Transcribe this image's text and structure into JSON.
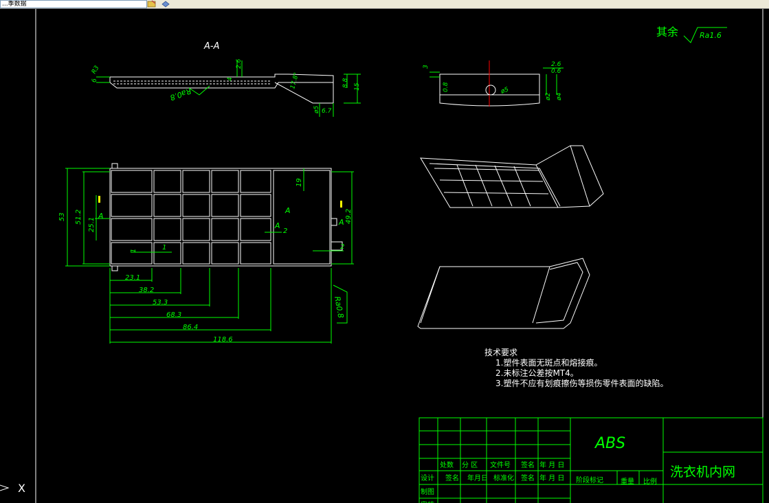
{
  "window": {
    "address_value": "...季数据",
    "colors": {
      "background": "#000000",
      "border": "#ffffff",
      "dim": "#00ff00",
      "frame": "#ffffff"
    }
  },
  "drawing": {
    "section_label": "A-A",
    "surface_finish_note": "其余",
    "surface_finish_value": "Ra1.6",
    "roughness_section": "Ra0.8",
    "roughness_plan": "Ra0.8",
    "material": "ABS",
    "company": "洗衣机内网",
    "section_dims": [
      "R3",
      "6",
      "2.6",
      "4",
      "17.8°",
      "8.8",
      "15",
      "ø5",
      "6.7"
    ],
    "side_dims": [
      "3",
      "0.8",
      "2.6",
      "0.6",
      "ø5",
      "ø2",
      "ø4"
    ],
    "plan_dims": {
      "h53": "53",
      "h512": "51.2",
      "h251": "25.1",
      "h19": "19",
      "h492": "49.2",
      "w1a": "1",
      "w1b": "1",
      "w2a": "2",
      "w2b": "2",
      "w231": "23.1",
      "w382": "38.2",
      "w533": "53.3",
      "w683": "68.3",
      "w864": "86.4",
      "w1186": "118.6",
      "secA1": "A",
      "secA2": "A",
      "secA3": "A",
      "secA4": "A"
    }
  },
  "tech_requirements": {
    "title": "技术要求",
    "items": [
      "1.塑件表面无斑点和熔接痕。",
      "2.未标注公差按MT4。",
      "3.塑件不应有划痕擦伤等损伤零件表面的缺陷。"
    ]
  },
  "title_block": {
    "row1": [
      "处数",
      "分 区",
      "文件号",
      "签名",
      "年 月 日"
    ],
    "row2": [
      "设计",
      "签名",
      "年月日",
      "标准化",
      "签名",
      "年 月 日"
    ],
    "row3": [
      "制图"
    ],
    "row4": [
      "审核"
    ],
    "stage": "阶段标记",
    "weight": "重量",
    "scale": "比例"
  },
  "ucs": {
    "x_label": "X"
  }
}
